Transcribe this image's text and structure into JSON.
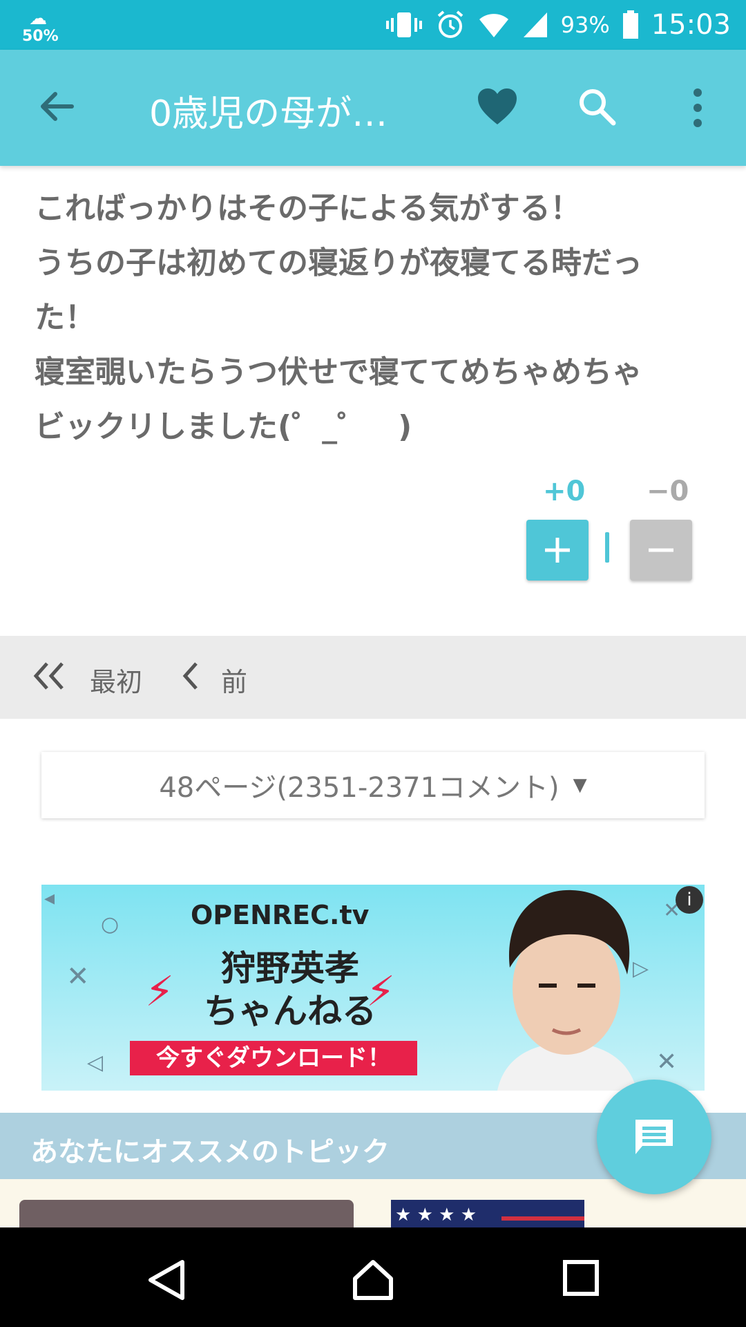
{
  "status_bar": {
    "weather_percent": "50%",
    "battery": "93%",
    "time": "15:03"
  },
  "app_bar": {
    "title": "0歳児の母が…"
  },
  "comment": {
    "lines": [
      "こればっかりはその子による気がする！",
      "うちの子は初めての寝返りが夜寝てる時だっ",
      "た！",
      "寝室覗いたらうつ伏せで寝ててめちゃめちゃ",
      "ビックリしました(゜_゜　)"
    ],
    "plus_count": "+0",
    "minus_count": "−0"
  },
  "pager": {
    "first_label": "最初",
    "prev_label": "前",
    "select_label": "48ページ(2351-2371コメント)"
  },
  "ad": {
    "logo": "OPENREC.tv",
    "headline_line1": "狩野英孝",
    "headline_line2": "ちゃんねる",
    "cta": "今すぐダウンロード！",
    "info": "i"
  },
  "recommend": {
    "header": "あなたにオススメのトピック"
  },
  "colors": {
    "status_bar": "#1bb8cf",
    "app_bar": "#5fcedd",
    "accent": "#4fc6d7",
    "minus": "#c4c4c4",
    "reco_header": "#add0df"
  }
}
